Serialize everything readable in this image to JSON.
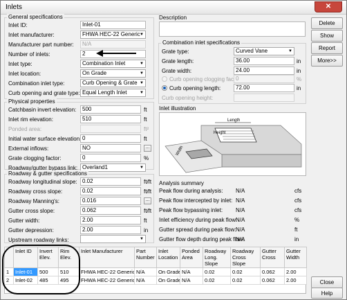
{
  "window": {
    "title": "Inlets",
    "close_glyph": "✕"
  },
  "general": {
    "title": "General specifications",
    "inlet_id": {
      "label": "Inlet ID:",
      "value": "Inlet-01"
    },
    "manufacturer": {
      "label": "Inlet manufacturer:",
      "value": "FHWA HEC-22 Generic"
    },
    "part_number": {
      "label": "Manufacturer part number:",
      "value": "N/A"
    },
    "num_inlets": {
      "label": "Number of inlets:",
      "value": "2"
    },
    "inlet_type": {
      "label": "Inlet type:",
      "value": "Combination Inlet"
    },
    "inlet_location": {
      "label": "Inlet location:",
      "value": "On Grade"
    },
    "combo_type": {
      "label": "Combination inlet type:",
      "value": "Curb Opening & Grate"
    },
    "curb_grate_type": {
      "label": "Curb opening and grate type:",
      "value": "Equal Length Inlet"
    }
  },
  "physical": {
    "title": "Physical properties",
    "catchbasin_invert": {
      "label": "Catchbasin invert elevation:",
      "value": "500",
      "unit": "ft"
    },
    "rim_elev": {
      "label": "Inlet rim elevation:",
      "value": "510",
      "unit": "ft"
    },
    "ponded_area": {
      "label": "Ponded area:",
      "value": "",
      "unit": "ft²"
    },
    "initial_wse": {
      "label": "Initial water surface elevation:",
      "value": "0",
      "unit": "ft"
    },
    "external_inflows": {
      "label": "External inflows:",
      "value": "NO"
    },
    "clogging": {
      "label": "Grate clogging factor:",
      "value": "0",
      "unit": "%"
    },
    "bypass_link": {
      "label": "Roadway/gutter bypass link:",
      "value": "Overland1"
    }
  },
  "roadway": {
    "title": "Roadway & gutter specifications",
    "long_slope": {
      "label": "Roadway longitudinal slope:",
      "value": "0.02",
      "unit": "ft/ft"
    },
    "cross_slope": {
      "label": "Roadway cross slope:",
      "value": "0.02",
      "unit": "ft/ft"
    },
    "mannings": {
      "label": "Roadway Manning's:",
      "value": "0.016"
    },
    "gutter_cross": {
      "label": "Gutter cross slope:",
      "value": "0.062",
      "unit": "ft/ft"
    },
    "gutter_width": {
      "label": "Gutter width:",
      "value": "2.00",
      "unit": "ft"
    },
    "gutter_depression": {
      "label": "Gutter depression:",
      "value": "2.00",
      "unit": "in"
    },
    "upstream_links": {
      "label": "Upstream roadway links:",
      "value": ""
    }
  },
  "description": {
    "title": "Description"
  },
  "combination": {
    "title": "Combination inlet specifications",
    "grate_type": {
      "label": "Grate type:",
      "value": "Curved Vane"
    },
    "grate_length": {
      "label": "Grate length:",
      "value": "36.00",
      "unit": "in"
    },
    "grate_width": {
      "label": "Grate width:",
      "value": "24.00",
      "unit": "in"
    },
    "curb_clogging": {
      "label": "Curb opening clogging factor:",
      "value": "0",
      "unit": "%"
    },
    "curb_length": {
      "label": "Curb opening length:",
      "value": "72.00",
      "unit": "in"
    },
    "curb_height": {
      "label": "Curb opening height:",
      "value": ""
    }
  },
  "illustration": {
    "title": "Inlet illustration",
    "labels": {
      "length": "Length",
      "height": "Height",
      "width": "Width"
    }
  },
  "analysis": {
    "title": "Analysis summary",
    "rows": [
      {
        "label": "Peak flow during analysis:",
        "value": "N/A",
        "unit": "cfs"
      },
      {
        "label": "Peak flow intercepted by inlet:",
        "value": "N/A",
        "unit": "cfs"
      },
      {
        "label": "Peak flow bypassing inlet:",
        "value": "N/A",
        "unit": "cfs"
      },
      {
        "label": "Inlet efficiency during peak flow:",
        "value": "N/A",
        "unit": "%"
      },
      {
        "label": "Gutter spread during peak flow:",
        "value": "N/A",
        "unit": "ft"
      },
      {
        "label": "Gutter flow depth during peak flow:",
        "value": "N/A",
        "unit": "in"
      }
    ]
  },
  "buttons": {
    "delete": "Delete",
    "show": "Show",
    "report": "Report",
    "more": "More>>",
    "close": "Close",
    "help": "Help",
    "ellipsis": "..."
  },
  "grid": {
    "headers": [
      "Inlet ID",
      "Invert Elev.",
      "Rim Elev.",
      "Inlet Manufacturer",
      "Part Number",
      "Inlet Location",
      "Ponded Area",
      "Roadway Long. Slope",
      "Roadway Cross Slope",
      "Gutter Cross",
      "Gutter Width"
    ],
    "rows": [
      [
        "1",
        "Inlet-01",
        "500",
        "510",
        "FHWA HEC-22 Generic",
        "N/A",
        "On Grade",
        "N/A",
        "0.02",
        "0.02",
        "0.062",
        "2.00"
      ],
      [
        "2",
        "Inlet-02",
        "485",
        "495",
        "FHWA HEC-22 Generic",
        "N/A",
        "On Grade",
        "N/A",
        "0.02",
        "0.02",
        "0.062",
        "2.00"
      ]
    ]
  }
}
